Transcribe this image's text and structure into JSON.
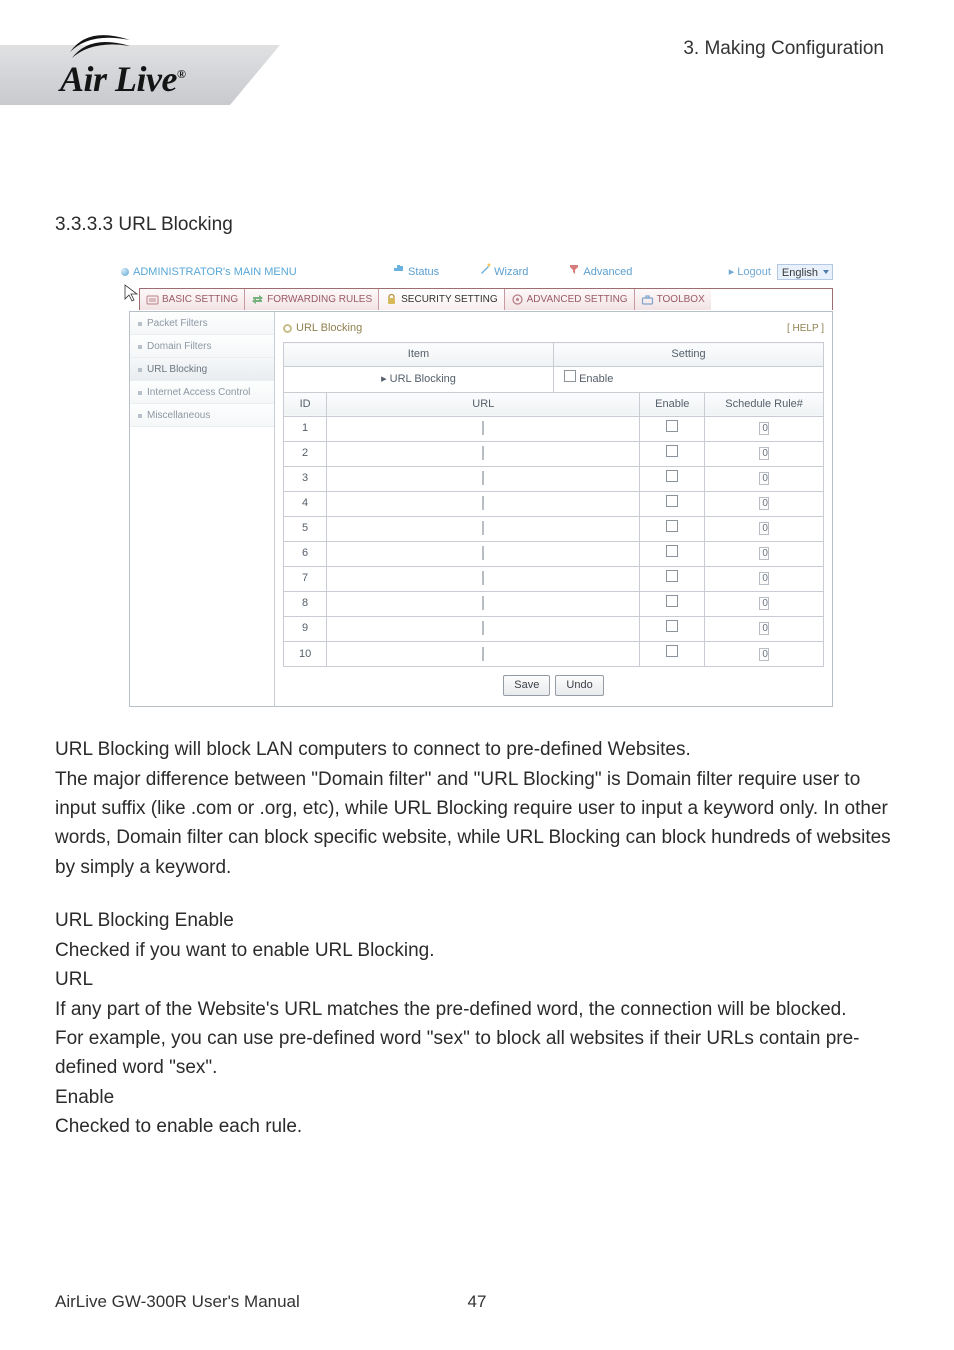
{
  "header": {
    "breadcrumb": "3.  Making  Configuration",
    "logo_text": "Air Live",
    "logo_reg": "®"
  },
  "section": {
    "title": "3.3.3.3 URL Blocking"
  },
  "screenshot": {
    "top": {
      "main_menu": "ADMINISTRATOR's MAIN MENU",
      "status": "Status",
      "wizard": "Wizard",
      "advanced": "Advanced",
      "logout": "Logout",
      "lang_selected": "English"
    },
    "tabs": {
      "basic": "BASIC SETTING",
      "forwarding": "FORWARDING RULES",
      "security": "SECURITY SETTING",
      "advset": "ADVANCED SETTING",
      "toolbox": "TOOLBOX"
    },
    "sidebar": {
      "items": [
        {
          "label": "Packet Filters"
        },
        {
          "label": "Domain Filters"
        },
        {
          "label": "URL Blocking"
        },
        {
          "label": "Internet Access Control"
        },
        {
          "label": "Miscellaneous"
        }
      ]
    },
    "content": {
      "title": "URL Blocking",
      "help": "[ HELP ]",
      "col_item": "Item",
      "col_setting": "Setting",
      "row_urlblocking": "URL Blocking",
      "row_enable": "Enable",
      "cols": {
        "id": "ID",
        "url": "URL",
        "enable": "Enable",
        "schedule": "Schedule Rule#"
      },
      "rows": [
        {
          "id": "1",
          "sched": "0"
        },
        {
          "id": "2",
          "sched": "0"
        },
        {
          "id": "3",
          "sched": "0"
        },
        {
          "id": "4",
          "sched": "0"
        },
        {
          "id": "5",
          "sched": "0"
        },
        {
          "id": "6",
          "sched": "0"
        },
        {
          "id": "7",
          "sched": "0"
        },
        {
          "id": "8",
          "sched": "0"
        },
        {
          "id": "9",
          "sched": "0"
        },
        {
          "id": "10",
          "sched": "0"
        }
      ],
      "save": "Save",
      "undo": "Undo"
    }
  },
  "body": {
    "para1": "URL Blocking will block LAN computers to connect to pre-defined Websites.\nThe major difference between \"Domain filter\" and \"URL Blocking\" is Domain filter require user to input suffix (like .com or .org, etc), while URL Blocking require user to input a keyword only. In other words, Domain filter can block specific website, while URL Blocking can block hundreds of websites by simply a keyword.",
    "h_enable": "URL Blocking Enable",
    "p_enable": "Checked if you want to enable URL Blocking.",
    "h_url": "URL",
    "p_url1": "If any part of the Website's URL matches the pre-defined word, the connection will be blocked.",
    "p_url2": "For example, you can use pre-defined word \"sex\" to block all websites if their URLs contain pre-defined word \"sex\".",
    "h_enable2": "Enable",
    "p_enable2": "Checked to enable each rule."
  },
  "footer": {
    "left": "AirLive GW-300R User's Manual",
    "page": "47"
  }
}
